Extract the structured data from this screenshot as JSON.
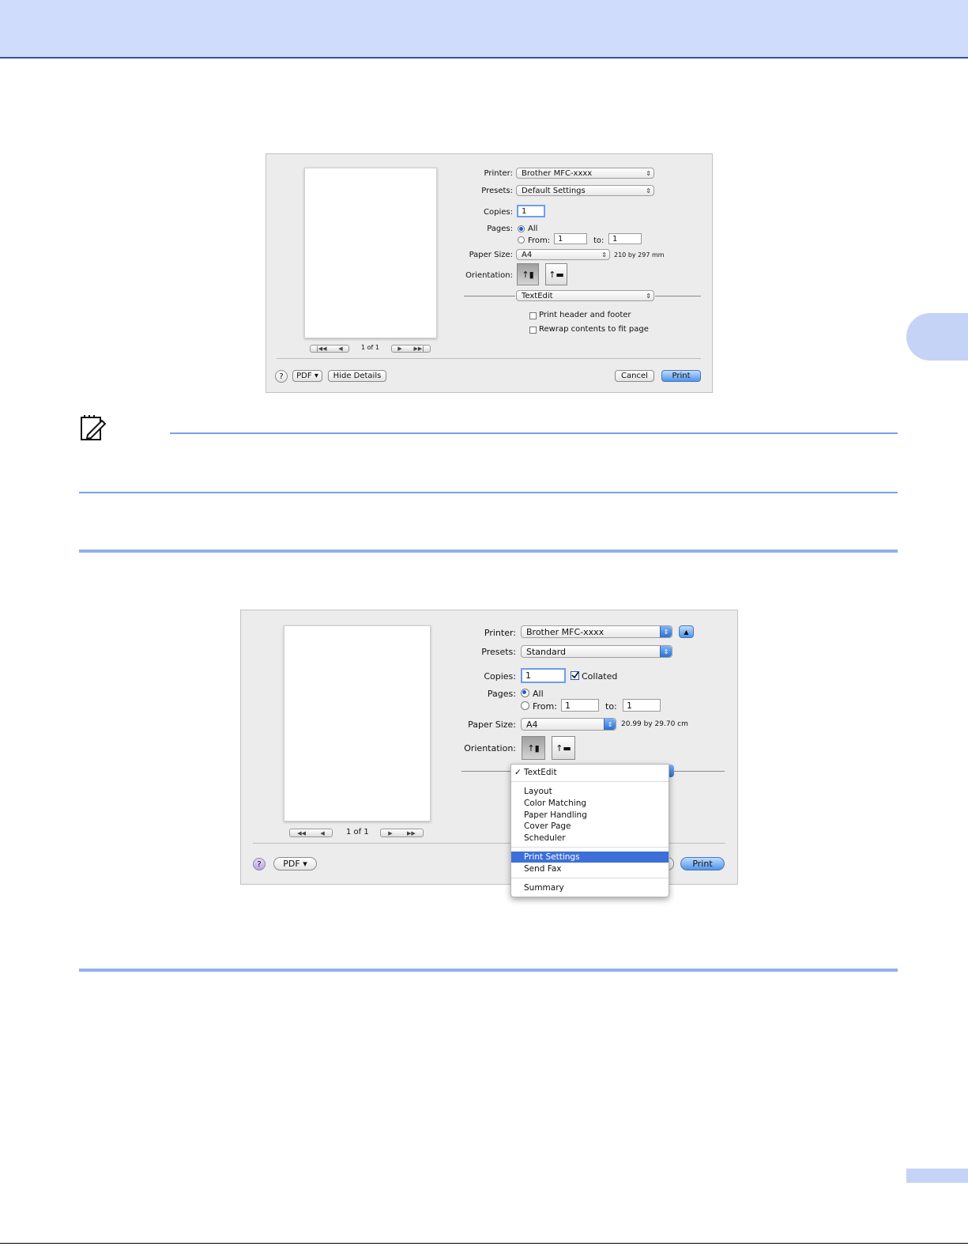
{
  "dialog1": {
    "printer_label": "Printer:",
    "printer_value": "Brother MFC-xxxx",
    "presets_label": "Presets:",
    "presets_value": "Default Settings",
    "copies_label": "Copies:",
    "copies_value": "1",
    "pages_label": "Pages:",
    "pages_all": "All",
    "pages_from": "From:",
    "from_value": "1",
    "to_label": "to:",
    "to_value": "1",
    "paper_size_label": "Paper Size:",
    "paper_size_value": "A4",
    "paper_dims": "210 by 297 mm",
    "orientation_label": "Orientation:",
    "section_value": "TextEdit",
    "option1": "Print header and footer",
    "option2": "Rewrap contents to fit page",
    "page_counter": "1 of 1",
    "help_label": "?",
    "pdf_label": "PDF ▾",
    "hide_details_label": "Hide Details",
    "cancel_label": "Cancel",
    "print_label": "Print"
  },
  "dialog2": {
    "printer_label": "Printer:",
    "printer_value": "Brother MFC-xxxx",
    "presets_label": "Presets:",
    "presets_value": "Standard",
    "copies_label": "Copies:",
    "copies_value": "1",
    "collated_label": "Collated",
    "pages_label": "Pages:",
    "pages_all": "All",
    "pages_from": "From:",
    "from_value": "1",
    "to_label": "to:",
    "to_value": "1",
    "paper_size_label": "Paper Size:",
    "paper_size_value": "A4",
    "paper_dims": "20.99 by 29.70 cm",
    "orientation_label": "Orientation:",
    "page_counter": "1 of 1",
    "help_label": "?",
    "pdf_label": "PDF ▾",
    "print_label": "Print",
    "menu": {
      "checked_item": "TextEdit",
      "items": [
        "Layout",
        "Color Matching",
        "Paper Handling",
        "Cover Page",
        "Scheduler"
      ],
      "highlighted_item": "Print Settings",
      "item_send_fax": "Send Fax",
      "item_summary": "Summary"
    }
  },
  "colors": {
    "header_band": "#cfdcfb",
    "rule_blue": "#7aa0ea",
    "menu_highlight": "#3d6fd9"
  },
  "icons": {
    "note": "pencil-note-icon",
    "checkmark": "checkmark-icon"
  }
}
